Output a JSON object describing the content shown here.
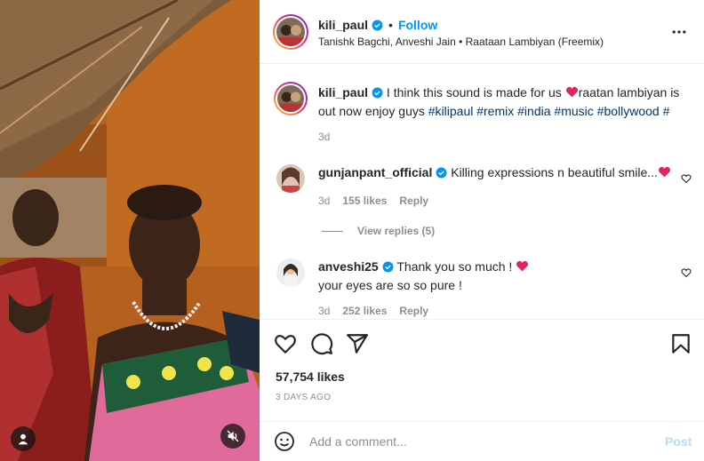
{
  "post": {
    "author": {
      "username": "kili_paul",
      "verified": true,
      "follow_label": "Follow",
      "dot": "•",
      "audio": "Tanishk Bagchi, Anveshi Jain • Raataan Lambiyan (Freemix)"
    },
    "more_icon": "more-horizontal-icon",
    "caption": {
      "username": "kili_paul",
      "text_before": "I think this sound is made for us ",
      "heart": "❤️",
      "text_after": "raatan lambiyan is out now enjoy guys ",
      "hashtags": [
        "#kilipaul",
        "#remix",
        "#india",
        "#music",
        "#bollywood",
        "#"
      ],
      "time": "3d"
    },
    "comments": [
      {
        "username": "gunjanpant_official",
        "verified": true,
        "text": "Killing expressions n beautiful smile...",
        "time": "3d",
        "likes": "155 likes",
        "reply_label": "Reply",
        "view_replies": "View replies (5)"
      },
      {
        "username": "anveshi25",
        "verified": true,
        "text_line1": "Thank you so much ! ",
        "text_line2": "your eyes are so so pure !",
        "time": "3d",
        "likes": "252 likes",
        "reply_label": "Reply"
      }
    ],
    "likes_count": "57,754 likes",
    "date": "3 DAYS AGO",
    "add_comment": {
      "placeholder": "Add a comment...",
      "post_label": "Post"
    },
    "icons": {
      "like": "heart-icon",
      "comment": "comment-icon",
      "share": "share-icon",
      "save": "bookmark-icon",
      "emoji": "emoji-icon",
      "tags": "user-tag-icon",
      "mute": "muted-speaker-icon"
    },
    "colors": {
      "link_blue": "#0095f6",
      "hashtag": "#00376b",
      "heart_red": "#ed4956",
      "muted_text": "#8e8e8e",
      "post_disabled": "#b2dffc"
    }
  }
}
